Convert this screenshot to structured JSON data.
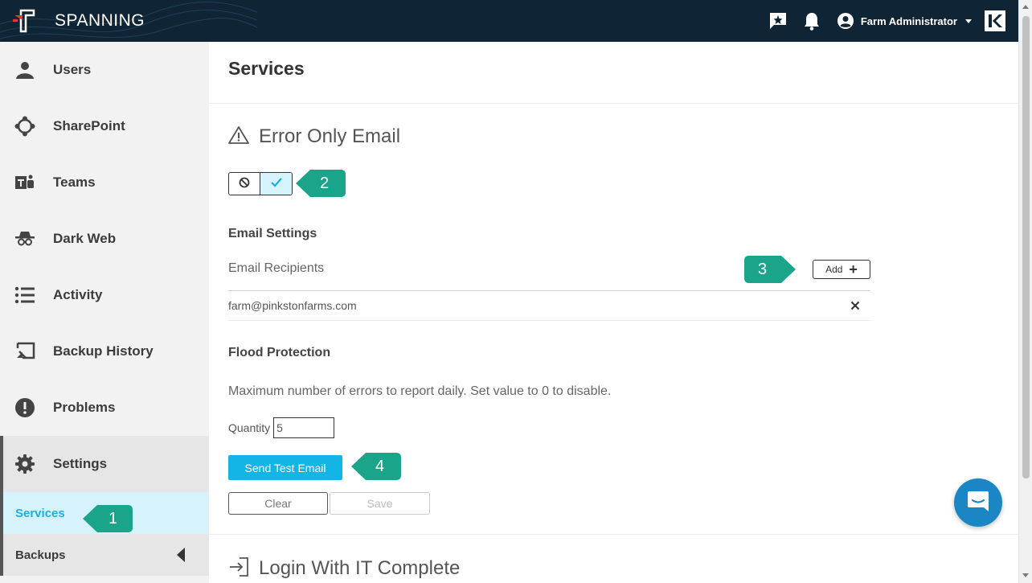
{
  "header": {
    "brand": "SPANNING",
    "user_name": "Farm Administrator",
    "icons": [
      "announcement-icon",
      "bell-icon",
      "account-icon",
      "kaseya-logo"
    ]
  },
  "sidebar": {
    "items": [
      {
        "label": "Users",
        "icon": "user-icon"
      },
      {
        "label": "SharePoint",
        "icon": "sharepoint-icon"
      },
      {
        "label": "Teams",
        "icon": "teams-icon"
      },
      {
        "label": "Dark Web",
        "icon": "spy-icon"
      },
      {
        "label": "Activity",
        "icon": "list-icon"
      },
      {
        "label": "Backup History",
        "icon": "history-icon"
      },
      {
        "label": "Problems",
        "icon": "alert-icon"
      },
      {
        "label": "Settings",
        "icon": "gear-icon"
      }
    ],
    "sub_items": [
      {
        "label": "Services",
        "active": true
      },
      {
        "label": "Backups",
        "active": false
      }
    ]
  },
  "main": {
    "page_title": "Services",
    "section_title": "Error Only Email",
    "toggle_state": "on",
    "email_settings_heading": "Email Settings",
    "recipients_label": "Email Recipients",
    "add_label": "Add",
    "recipients": [
      "farm@pinkstonfarms.com"
    ],
    "flood_heading": "Flood Protection",
    "flood_description": "Maximum number of errors to report daily. Set value to 0 to disable.",
    "quantity_label": "Quantity",
    "quantity_value": "5",
    "send_test_label": "Send Test Email",
    "clear_label": "Clear",
    "save_label": "Save",
    "next_section_title": "Login With IT Complete"
  },
  "callouts": [
    "1",
    "2",
    "3",
    "4"
  ],
  "colors": {
    "topbar": "#0f2535",
    "accent": "#12b5e6",
    "callout": "#1aa58a",
    "active_bg": "#d6f3fb",
    "chat": "#1a87c4"
  }
}
